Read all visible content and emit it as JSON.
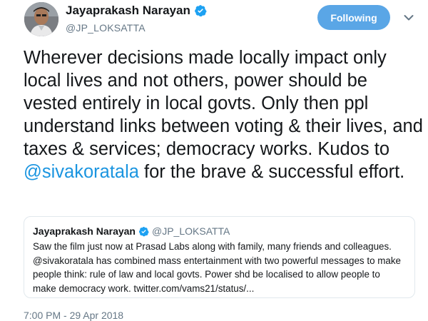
{
  "author": {
    "display_name": "Jayaprakash Narayan",
    "handle": "@JP_LOKSATTA",
    "verified": true
  },
  "follow_button": {
    "label": "Following"
  },
  "menu_icon": "chevron-down-icon",
  "tweet": {
    "text_before_mention": "Wherever decisions made locally impact only local lives and not others, power should be vested entirely in local govts. Only then ppl understand links between voting & their lives, and taxes & services; democracy works. Kudos to ",
    "mention": "@sivakoratala",
    "text_after_mention": " for the brave & successful effort."
  },
  "quoted_tweet": {
    "display_name": "Jayaprakash Narayan",
    "handle": "@JP_LOKSATTA",
    "verified": true,
    "text": "Saw the film just now at Prasad Labs along with family, many friends and colleagues.\n@sivakoratala has combined mass entertainment with two powerful messages to make\npeople think: rule of law and local govts. Power shd be localised to allow people to\nmake democracy work. twitter.com/vams21/status/..."
  },
  "timestamp": "7:00 PM - 29 Apr 2018",
  "colors": {
    "accent": "#1b95e0",
    "follow_button_bg": "#5aa6e6",
    "secondary_text": "#657786",
    "border": "#e1e8ed"
  }
}
